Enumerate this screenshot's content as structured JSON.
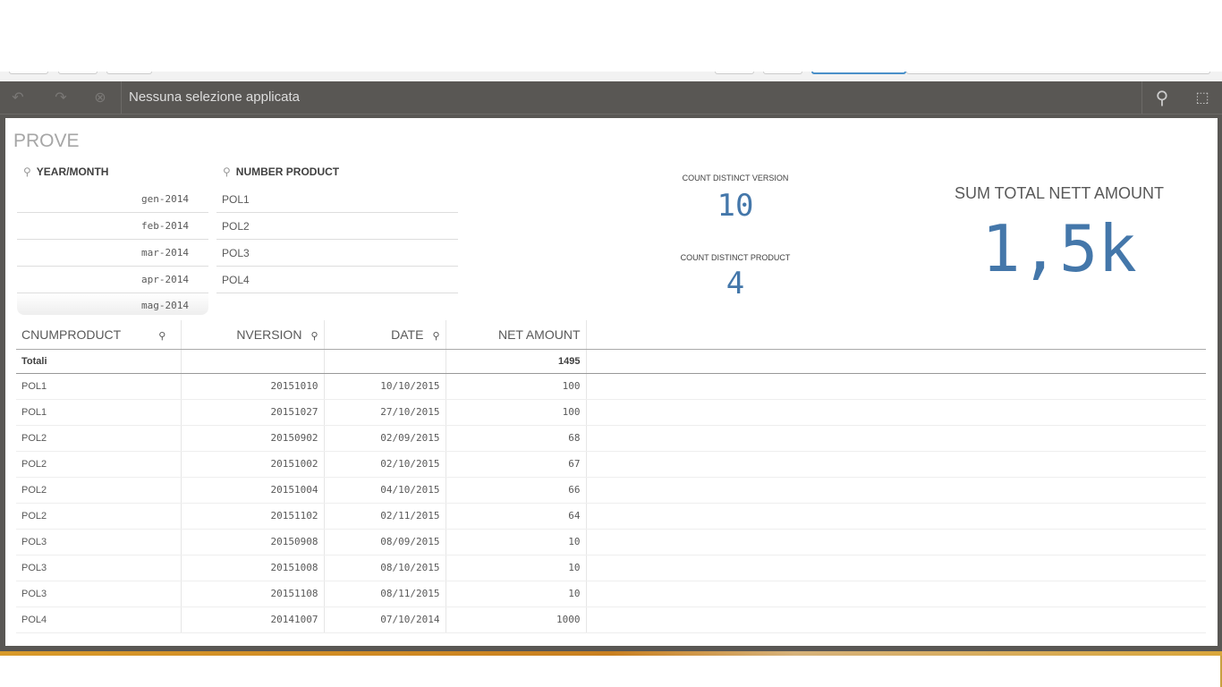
{
  "selection_bar": {
    "text": "Nessuna selezione applicata"
  },
  "sheet": {
    "title": "PROVE"
  },
  "filters": [
    {
      "label": "YEAR/MONTH",
      "items": [
        "gen-2014",
        "feb-2014",
        "mar-2014",
        "apr-2014",
        "mag-2014"
      ]
    },
    {
      "label": "NUMBER PRODUCT",
      "items": [
        "POL1",
        "POL2",
        "POL3",
        "POL4"
      ]
    }
  ],
  "kpis": {
    "version": {
      "label": "COUNT DISTINCT VERSION",
      "value": "10"
    },
    "product": {
      "label": "COUNT DISTINCT PRODUCT",
      "value": "4"
    },
    "amount": {
      "label": "SUM TOTAL NETT AMOUNT",
      "value": "1,5k"
    }
  },
  "table": {
    "headers": [
      "CNUMPRODUCT",
      "NVERSION",
      "DATE",
      "NET AMOUNT"
    ],
    "totals_label": "Totali",
    "totals_value": "1495",
    "rows": [
      [
        "POL1",
        "20151010",
        "10/10/2015",
        "100"
      ],
      [
        "POL1",
        "20151027",
        "27/10/2015",
        "100"
      ],
      [
        "POL2",
        "20150902",
        "02/09/2015",
        "68"
      ],
      [
        "POL2",
        "20151002",
        "02/10/2015",
        "67"
      ],
      [
        "POL2",
        "20151004",
        "04/10/2015",
        "66"
      ],
      [
        "POL2",
        "20151102",
        "02/11/2015",
        "64"
      ],
      [
        "POL3",
        "20150908",
        "08/09/2015",
        "10"
      ],
      [
        "POL3",
        "20151008",
        "08/10/2015",
        "10"
      ],
      [
        "POL3",
        "20151108",
        "08/11/2015",
        "10"
      ],
      [
        "POL4",
        "20141007",
        "07/10/2014",
        "1000"
      ]
    ]
  },
  "colors": {
    "accent": "#4477aa",
    "bar": "#595754"
  }
}
